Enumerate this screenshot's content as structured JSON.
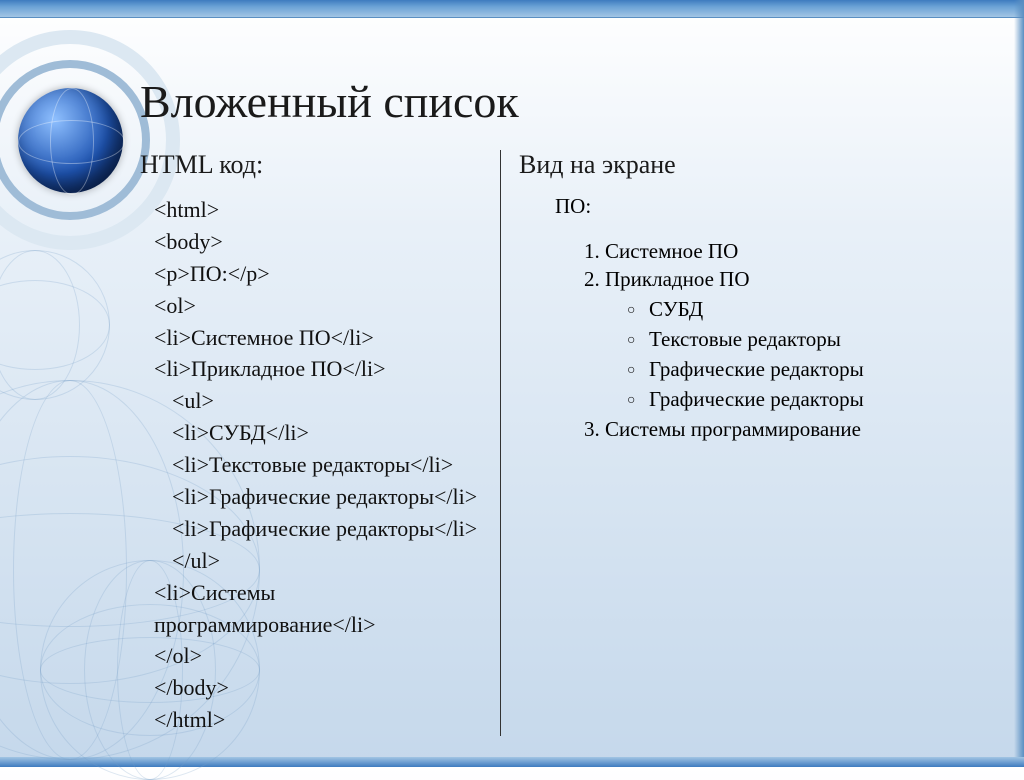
{
  "title": "Вложенный список",
  "left_header": "HTML код:",
  "right_header": "Вид на экране",
  "code": {
    "l1": "<html>",
    "l2": "<body>",
    "l3": "<p>ПО:</p>",
    "l4": "<ol>",
    "l5": "<li>Системное ПО</li>",
    "l6": "<li>Прикладное ПО</li>",
    "l7": "<ul>",
    "l8": "<li>СУБД</li>",
    "l9": "<li>Текстовые редакторы</li>",
    "l10": "<li>Графические редакторы</li>",
    "l11": "<li>Графические редакторы</li>",
    "l12": "</ul>",
    "l13": "<li>Системы программирование</li>",
    "l14": "</ol>",
    "l15": "</body>",
    "l16": "</html>"
  },
  "output": {
    "heading": "ПО:",
    "item1": "Системное ПО",
    "item2": "Прикладное ПО",
    "sub1": "СУБД",
    "sub2": "Текстовые редакторы",
    "sub3": "Графические редакторы",
    "sub4": "Графические редакторы",
    "item3": "Системы программирование"
  }
}
